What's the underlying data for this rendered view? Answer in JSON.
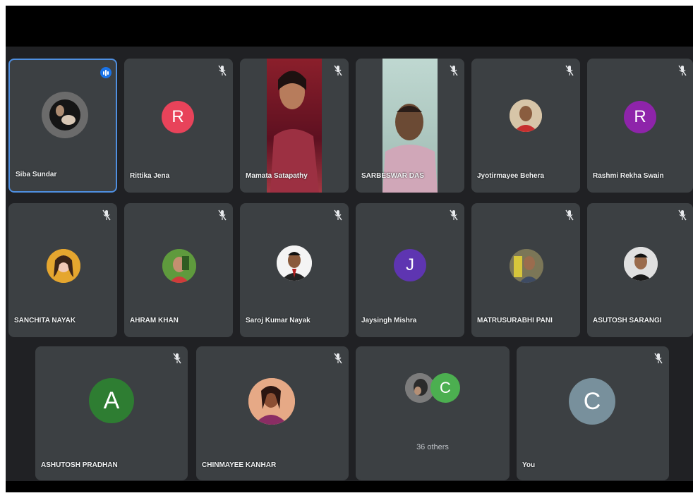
{
  "meeting": {
    "colors": {
      "background": "#202124",
      "tile": "#3c4043",
      "active_border": "#4f8fe0",
      "speaking_badge": "#1a73e8"
    },
    "participants": [
      {
        "name": "Siba Sundar",
        "type": "photo",
        "muted": false,
        "speaking": true
      },
      {
        "name": "Rittika Jena",
        "type": "initial",
        "initial": "R",
        "color": "#e8435a",
        "muted": true
      },
      {
        "name": "Mamata Satapathy",
        "type": "video",
        "muted": true
      },
      {
        "name": "SARBESWAR DAS",
        "type": "video",
        "muted": true
      },
      {
        "name": "Jyotirmayee Behera",
        "type": "photo",
        "muted": true
      },
      {
        "name": "Rashmi Rekha Swain",
        "type": "initial",
        "initial": "R",
        "color": "#8e24aa",
        "muted": true
      },
      {
        "name": "SANCHITA NAYAK",
        "type": "photo",
        "muted": true
      },
      {
        "name": "AHRAM KHAN",
        "type": "photo",
        "muted": true
      },
      {
        "name": "Saroj Kumar Nayak",
        "type": "photo",
        "muted": true
      },
      {
        "name": "Jaysingh Mishra",
        "type": "initial",
        "initial": "J",
        "color": "#5e35b1",
        "muted": true
      },
      {
        "name": "MATRUSURABHI PANI",
        "type": "photo",
        "muted": true
      },
      {
        "name": "ASUTOSH SARANGI",
        "type": "photo",
        "muted": true
      },
      {
        "name": "ASHUTOSH PRADHAN",
        "type": "initial",
        "initial": "A",
        "color": "#2e7d32",
        "muted": true
      },
      {
        "name": "CHINMAYEE KANHAR",
        "type": "photo",
        "muted": true
      },
      {
        "name": "You",
        "type": "initial",
        "initial": "C",
        "color": "#78909c",
        "muted": true
      }
    ],
    "others": {
      "label": "36 others",
      "initial": "C",
      "color": "#4caf50"
    }
  }
}
